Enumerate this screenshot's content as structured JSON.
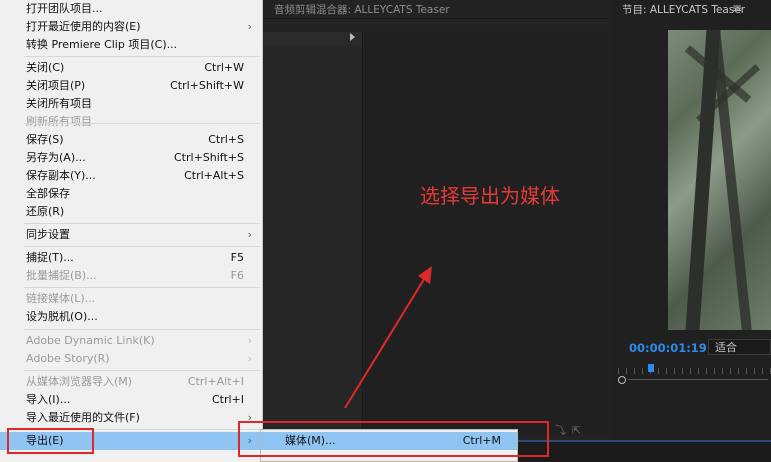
{
  "mixer_panel": {
    "title": "音频剪辑混合器: ALLEYCATS Teaser"
  },
  "program_panel": {
    "title": "节目: ALLEYCATS Teaser",
    "menu_glyph": "≡",
    "timecode": "00:00:01:19",
    "fit_label": "适合"
  },
  "annotation_text": "选择导出为媒体",
  "file_menu": {
    "items": [
      {
        "label": "打开团队项目...",
        "shortcut": "",
        "submenu": false,
        "disabled": false
      },
      {
        "label": "打开最近使用的内容(E)",
        "shortcut": "",
        "submenu": true,
        "disabled": false
      },
      {
        "label": "转换 Premiere Clip 项目(C)...",
        "shortcut": "",
        "submenu": false,
        "disabled": false
      },
      {
        "label": "关闭(C)",
        "shortcut": "Ctrl+W",
        "submenu": false,
        "disabled": false
      },
      {
        "label": "关闭项目(P)",
        "shortcut": "Ctrl+Shift+W",
        "submenu": false,
        "disabled": false
      },
      {
        "label": "关闭所有项目",
        "shortcut": "",
        "submenu": false,
        "disabled": false
      },
      {
        "label": "刷新所有项目",
        "shortcut": "",
        "submenu": false,
        "disabled": true
      },
      {
        "label": "保存(S)",
        "shortcut": "Ctrl+S",
        "submenu": false,
        "disabled": false
      },
      {
        "label": "另存为(A)...",
        "shortcut": "Ctrl+Shift+S",
        "submenu": false,
        "disabled": false
      },
      {
        "label": "保存副本(Y)...",
        "shortcut": "Ctrl+Alt+S",
        "submenu": false,
        "disabled": false
      },
      {
        "label": "全部保存",
        "shortcut": "",
        "submenu": false,
        "disabled": false
      },
      {
        "label": "还原(R)",
        "shortcut": "",
        "submenu": false,
        "disabled": false
      },
      {
        "label": "同步设置",
        "shortcut": "",
        "submenu": true,
        "disabled": false
      },
      {
        "label": "捕捉(T)...",
        "shortcut": "F5",
        "submenu": false,
        "disabled": false
      },
      {
        "label": "批量捕捉(B)...",
        "shortcut": "F6",
        "submenu": false,
        "disabled": true
      },
      {
        "label": "链接媒体(L)...",
        "shortcut": "",
        "submenu": false,
        "disabled": true
      },
      {
        "label": "设为脱机(O)...",
        "shortcut": "",
        "submenu": false,
        "disabled": false
      },
      {
        "label": "Adobe Dynamic Link(K)",
        "shortcut": "",
        "submenu": true,
        "disabled": true
      },
      {
        "label": "Adobe Story(R)",
        "shortcut": "",
        "submenu": true,
        "disabled": true
      },
      {
        "label": "从媒体浏览器导入(M)",
        "shortcut": "Ctrl+Alt+I",
        "submenu": false,
        "disabled": true
      },
      {
        "label": "导入(I)...",
        "shortcut": "Ctrl+I",
        "submenu": false,
        "disabled": false
      },
      {
        "label": "导入最近使用的文件(F)",
        "shortcut": "",
        "submenu": true,
        "disabled": false
      },
      {
        "label": "导出(E)",
        "shortcut": "",
        "submenu": true,
        "disabled": false
      }
    ]
  },
  "export_submenu": {
    "items": [
      {
        "label": "媒体(M)...",
        "shortcut": "Ctrl+M"
      }
    ]
  },
  "colors": {
    "highlight": "#8fc4f3",
    "annotation_red": "#e0282a",
    "timecode_blue": "#2d8ceb"
  }
}
